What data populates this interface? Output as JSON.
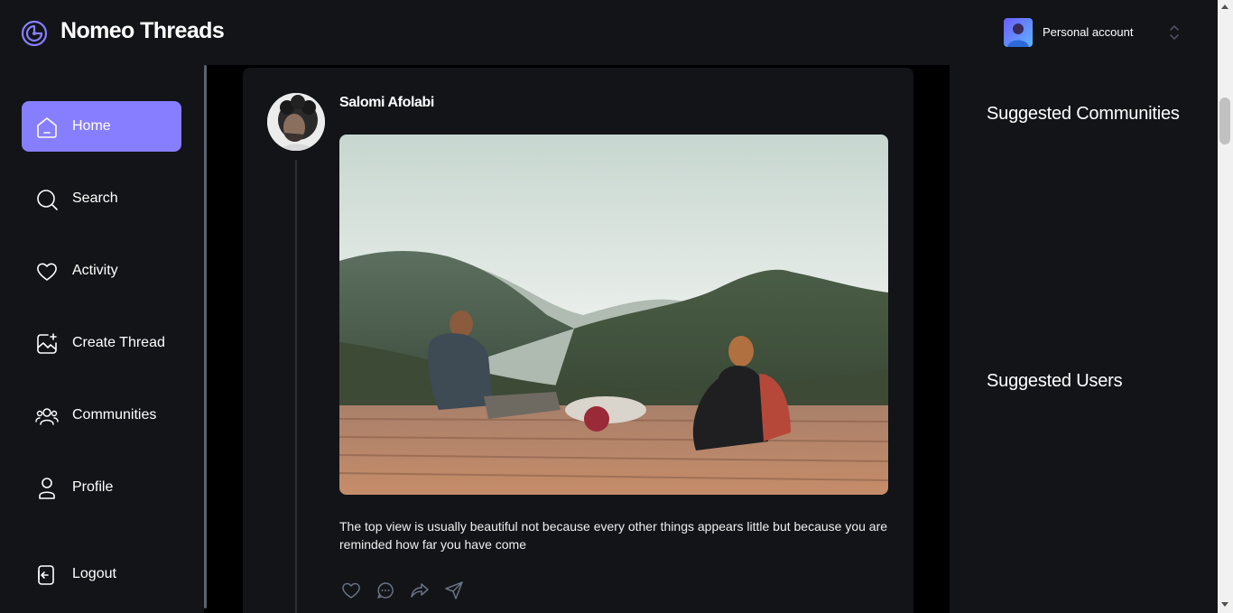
{
  "app": {
    "brand": "Nomeo Threads"
  },
  "account": {
    "label": "Personal account"
  },
  "nav": {
    "home": "Home",
    "search": "Search",
    "activity": "Activity",
    "create_thread": "Create Thread",
    "communities": "Communities",
    "profile": "Profile",
    "logout": "Logout"
  },
  "post": {
    "author": "Salomi Afolabi",
    "text": "The top view is usually beautiful not because every other things appears little but because you are reminded how far you have come"
  },
  "rightbar": {
    "suggested_communities": "Suggested Communities",
    "suggested_users": "Suggested Users"
  },
  "colors": {
    "accent": "#877eff",
    "surface": "#121417",
    "background": "#000000"
  },
  "icons": [
    "logo-icon",
    "home-icon",
    "search-icon",
    "heart-icon",
    "create-thread-icon",
    "communities-icon",
    "profile-icon",
    "logout-icon",
    "like-icon",
    "reply-icon",
    "repost-icon",
    "share-icon",
    "chevron-updown-icon"
  ]
}
